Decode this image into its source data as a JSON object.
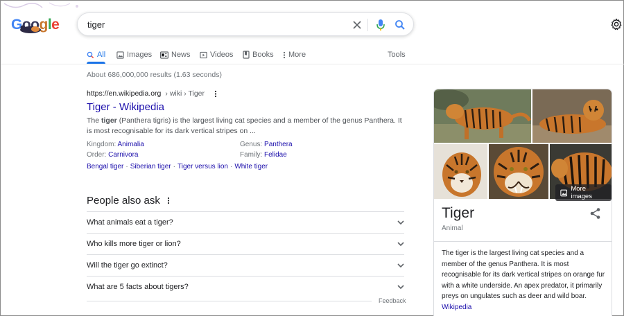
{
  "search": {
    "query": "tiger",
    "logo_text": "Google"
  },
  "tabs": [
    {
      "label": "All",
      "icon": "search-icon",
      "active": true
    },
    {
      "label": "Images",
      "icon": "image-icon"
    },
    {
      "label": "News",
      "icon": "news-icon"
    },
    {
      "label": "Videos",
      "icon": "video-icon"
    },
    {
      "label": "Books",
      "icon": "book-icon"
    },
    {
      "label": "More",
      "icon": "more-vert-icon"
    },
    {
      "label": "Tools"
    }
  ],
  "stats": "About 686,000,000 results (1.63 seconds)",
  "result": {
    "url": "https://en.wikipedia.org",
    "path": "› wiki › Tiger",
    "title": "Tiger - Wikipedia",
    "snippet_pre": "The ",
    "snippet_bold": "tiger",
    "snippet_post": " (Panthera tigris) is the largest living cat species and a member of the genus Panthera. It is most recognisable for its dark vertical stripes on ...",
    "facts": [
      {
        "label": "Kingdom: ",
        "value": "Animalia"
      },
      {
        "label": "Genus: ",
        "value": "Panthera"
      },
      {
        "label": "Order: ",
        "value": "Carnivora"
      },
      {
        "label": "Family: ",
        "value": "Felidae"
      }
    ],
    "sitelinks": [
      "Bengal tiger",
      "Siberian tiger",
      "Tiger versus lion",
      "White tiger"
    ]
  },
  "paa": {
    "title": "People also ask",
    "questions": [
      "What animals eat a tiger?",
      "Who kills more tiger or lion?",
      "Will the tiger go extinct?",
      "What are 5 facts about tigers?"
    ],
    "feedback": "Feedback"
  },
  "knowledge_panel": {
    "more_images": "More images",
    "title": "Tiger",
    "subtitle": "Animal",
    "description": "The tiger is the largest living cat species and a member of the genus Panthera. It is most recognisable for its dark vertical stripes on orange fur with a white underside. An apex predator, it primarily preys on ungulates such as deer and wild boar.",
    "source": "Wikipedia"
  },
  "colors": {
    "accent": "#1a73e8",
    "link": "#1a0dab",
    "tiger_orange": "#c8762c"
  }
}
